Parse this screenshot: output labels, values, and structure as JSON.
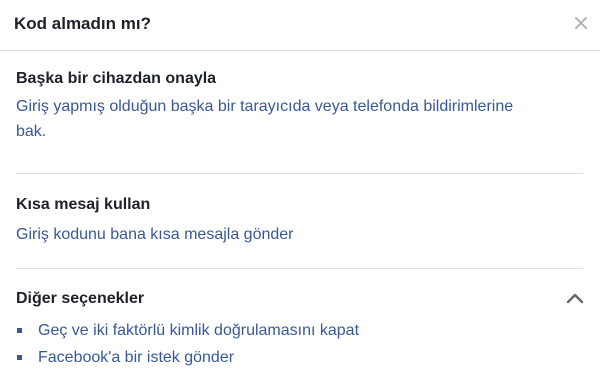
{
  "dialog": {
    "title": "Kod almadın mı?",
    "close_icon": "close-icon"
  },
  "device_section": {
    "title": "Başka bir cihazdan onayla",
    "text": "Giriş yapmış olduğun başka bir tarayıcıda veya telefonda bildirimlerine bak."
  },
  "sms_section": {
    "title": "Kısa mesaj kullan",
    "link": "Giriş kodunu bana kısa mesajla gönder"
  },
  "other_section": {
    "title": "Diğer seçenekler",
    "toggle_icon": "chevron-up-icon",
    "items": [
      {
        "label": "Geç ve iki faktörlü kimlik doğrulamasını kapat"
      },
      {
        "label": "Facebook'a bir istek gönder"
      }
    ]
  },
  "colors": {
    "link": "#385898",
    "text": "#1d2129",
    "divider": "#dddfe2"
  }
}
